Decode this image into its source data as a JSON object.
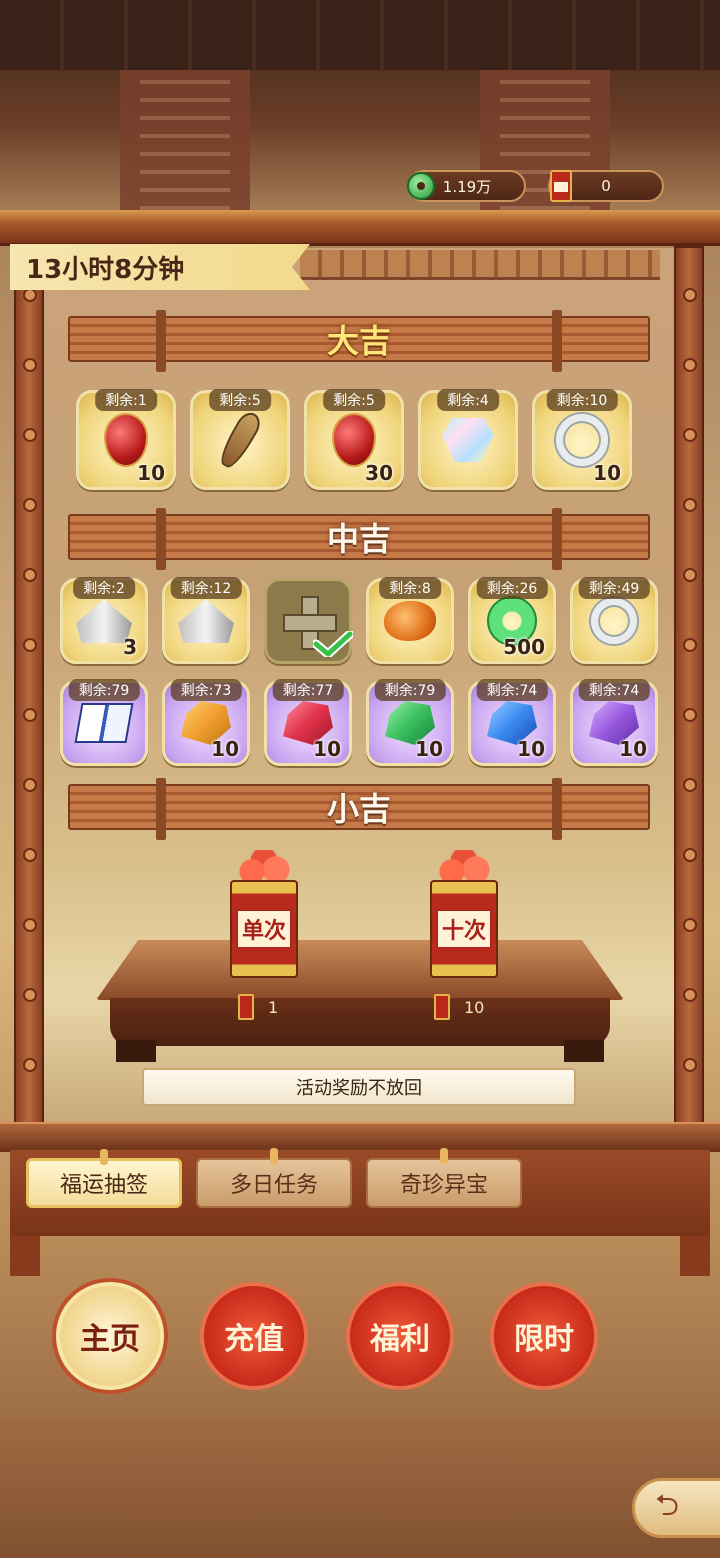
{
  "currencies": {
    "jade": "1.19万",
    "fu_tokens": "0"
  },
  "timer": "13小时8分钟",
  "tiers": {
    "daji": {
      "title": "大吉",
      "items": [
        {
          "remain": "剩余:1",
          "qty": "10",
          "icon": "red-gourd-icon"
        },
        {
          "remain": "剩余:5",
          "qty": "",
          "icon": "pipa-icon"
        },
        {
          "remain": "剩余:5",
          "qty": "30",
          "icon": "red-gourd-icon"
        },
        {
          "remain": "剩余:4",
          "qty": "",
          "icon": "crystal-gem-icon"
        },
        {
          "remain": "剩余:10",
          "qty": "10",
          "icon": "silver-ring-icon"
        }
      ]
    },
    "zhongji": {
      "title": "中吉",
      "items": [
        {
          "remain": "剩余:2",
          "qty": "3",
          "icon": "tent-icon"
        },
        {
          "remain": "剩余:12",
          "qty": "",
          "icon": "tent-icon"
        },
        {
          "remain": "",
          "qty": "",
          "icon": "cross-beam-icon",
          "claimed": true
        },
        {
          "remain": "剩余:8",
          "qty": "",
          "icon": "amber-stone-icon"
        },
        {
          "remain": "剩余:26",
          "qty": "500",
          "icon": "jade-disc-icon"
        },
        {
          "remain": "剩余:49",
          "qty": "",
          "icon": "silver-ring-icon"
        }
      ],
      "items2": [
        {
          "remain": "剩余:79",
          "qty": "",
          "icon": "book-icon"
        },
        {
          "remain": "剩余:73",
          "qty": "10",
          "icon": "orange-crystal-icon",
          "color": "#f0a030"
        },
        {
          "remain": "剩余:77",
          "qty": "10",
          "icon": "red-crystal-icon",
          "color": "#e0324a"
        },
        {
          "remain": "剩余:79",
          "qty": "10",
          "icon": "green-crystal-icon",
          "color": "#3ac060"
        },
        {
          "remain": "剩余:74",
          "qty": "10",
          "icon": "blue-crystal-icon",
          "color": "#3a8af0"
        },
        {
          "remain": "剩余:74",
          "qty": "10",
          "icon": "purple-crystal-icon",
          "color": "#9a5ae0"
        }
      ]
    },
    "xiaoji": {
      "title": "小吉"
    }
  },
  "draw": {
    "single_label": "单次",
    "ten_label": "十次",
    "single_cost": "1",
    "ten_cost": "10",
    "notice": "活动奖励不放回"
  },
  "tabs": [
    "福运抽签",
    "多日任务",
    "奇珍异宝"
  ],
  "nav": [
    "主页",
    "充值",
    "福利",
    "限时"
  ],
  "colors": {
    "gold_text": "#ffe57a",
    "board": "#c7a176",
    "nav_red": "#c82a1a"
  }
}
